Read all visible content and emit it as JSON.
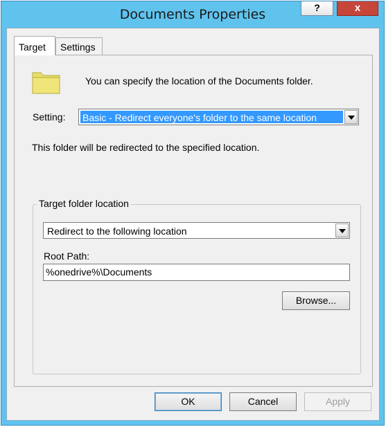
{
  "window": {
    "title": "Documents Properties",
    "help_label": "?",
    "close_label": "x"
  },
  "tabs": [
    {
      "label": "Target",
      "active": true
    },
    {
      "label": "Settings",
      "active": false
    }
  ],
  "target": {
    "header_text": "You can specify the location of the Documents folder.",
    "setting_label": "Setting:",
    "setting_value": "Basic - Redirect everyone's folder to the same location",
    "description": "This folder will be redirected to the specified location.",
    "group_label": "Target folder location",
    "location_value": "Redirect to the following location",
    "root_path_label": "Root Path:",
    "root_path_value": "%onedrive%\\Documents",
    "browse_label": "Browse..."
  },
  "buttons": {
    "ok": "OK",
    "cancel": "Cancel",
    "apply": "Apply"
  },
  "colors": {
    "titlebar": "#5fc3ee",
    "close": "#c7463a",
    "selection": "#3399ff",
    "folder": "#e8df6a"
  }
}
